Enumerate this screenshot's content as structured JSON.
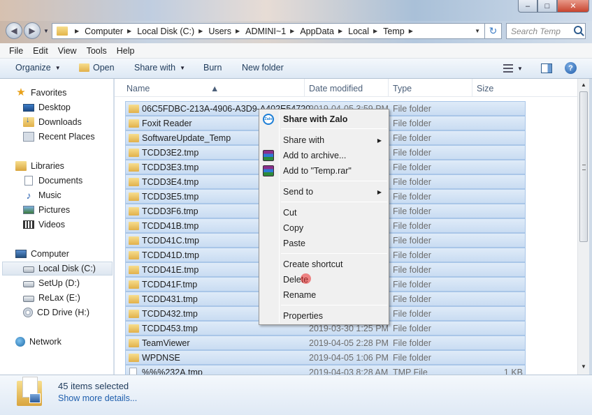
{
  "window": {
    "minimize_symbol": "‒",
    "maximize_symbol": "□",
    "close_symbol": "✕"
  },
  "nav": {
    "back_symbol": "◀",
    "forward_symbol": "▶",
    "breadcrumbs": [
      "Computer",
      "Local Disk (C:)",
      "Users",
      "ADMINI~1",
      "AppData",
      "Local",
      "Temp"
    ],
    "refresh_symbol": "↻",
    "search_placeholder": "Search Temp"
  },
  "menubar": [
    "File",
    "Edit",
    "View",
    "Tools",
    "Help"
  ],
  "toolbar": {
    "organize": "Organize",
    "open": "Open",
    "share_with": "Share with",
    "burn": "Burn",
    "new_folder": "New folder"
  },
  "sidebar": {
    "favorites": "Favorites",
    "desktop": "Desktop",
    "downloads": "Downloads",
    "recent_places": "Recent Places",
    "libraries": "Libraries",
    "documents": "Documents",
    "music": "Music",
    "pictures": "Pictures",
    "videos": "Videos",
    "computer": "Computer",
    "local_disk": "Local Disk (C:)",
    "setup": "SetUp (D:)",
    "relax": "ReLax (E:)",
    "cd_drive": "CD Drive (H:)",
    "network": "Network"
  },
  "columns": {
    "name": "Name",
    "date_modified": "Date modified",
    "type": "Type",
    "size": "Size"
  },
  "files": [
    {
      "name": "06C5FDBC-213A-4906-A3D9-A402E54720...",
      "date": "2019-04-05 3:59 PM",
      "type": "File folder",
      "size": "",
      "kind": "folder"
    },
    {
      "name": "Foxit Reader",
      "date": "",
      "type": "File folder",
      "size": "",
      "kind": "folder"
    },
    {
      "name": "SoftwareUpdate_Temp",
      "date": "",
      "type": "File folder",
      "size": "",
      "kind": "folder"
    },
    {
      "name": "TCDD3E2.tmp",
      "date": "",
      "type": "File folder",
      "size": "",
      "kind": "folder"
    },
    {
      "name": "TCDD3E3.tmp",
      "date": "",
      "type": "File folder",
      "size": "",
      "kind": "folder"
    },
    {
      "name": "TCDD3E4.tmp",
      "date": "",
      "type": "File folder",
      "size": "",
      "kind": "folder"
    },
    {
      "name": "TCDD3E5.tmp",
      "date": "",
      "type": "File folder",
      "size": "",
      "kind": "folder"
    },
    {
      "name": "TCDD3F6.tmp",
      "date": "",
      "type": "File folder",
      "size": "",
      "kind": "folder"
    },
    {
      "name": "TCDD41B.tmp",
      "date": "",
      "type": "File folder",
      "size": "",
      "kind": "folder"
    },
    {
      "name": "TCDD41C.tmp",
      "date": "",
      "type": "File folder",
      "size": "",
      "kind": "folder"
    },
    {
      "name": "TCDD41D.tmp",
      "date": "",
      "type": "File folder",
      "size": "",
      "kind": "folder"
    },
    {
      "name": "TCDD41E.tmp",
      "date": "",
      "type": "File folder",
      "size": "",
      "kind": "folder"
    },
    {
      "name": "TCDD41F.tmp",
      "date": "",
      "type": "File folder",
      "size": "",
      "kind": "folder"
    },
    {
      "name": "TCDD431.tmp",
      "date": "",
      "type": "File folder",
      "size": "",
      "kind": "folder"
    },
    {
      "name": "TCDD432.tmp",
      "date": "",
      "type": "File folder",
      "size": "",
      "kind": "folder"
    },
    {
      "name": "TCDD453.tmp",
      "date": "2019-03-30 1:25 PM",
      "type": "File folder",
      "size": "",
      "kind": "folder"
    },
    {
      "name": "TeamViewer",
      "date": "2019-04-05 2:28 PM",
      "type": "File folder",
      "size": "",
      "kind": "folder"
    },
    {
      "name": "WPDNSE",
      "date": "2019-04-05 1:06 PM",
      "type": "File folder",
      "size": "",
      "kind": "folder"
    },
    {
      "name": "%%%232A.tmp",
      "date": "2019-04-03 8:28 AM",
      "type": "TMP File",
      "size": "1 KB",
      "kind": "file"
    }
  ],
  "context_menu": {
    "share_with_zalo": "Share with Zalo",
    "zalo_badge": "Zalo",
    "share_with": "Share with",
    "add_to_archive": "Add to archive...",
    "add_to_temp_rar": "Add to \"Temp.rar\"",
    "send_to": "Send to",
    "cut": "Cut",
    "copy": "Copy",
    "paste": "Paste",
    "create_shortcut": "Create shortcut",
    "delete": "Delete",
    "rename": "Rename",
    "properties": "Properties"
  },
  "details": {
    "selected_count": "45 items selected",
    "show_more": "Show more details..."
  }
}
